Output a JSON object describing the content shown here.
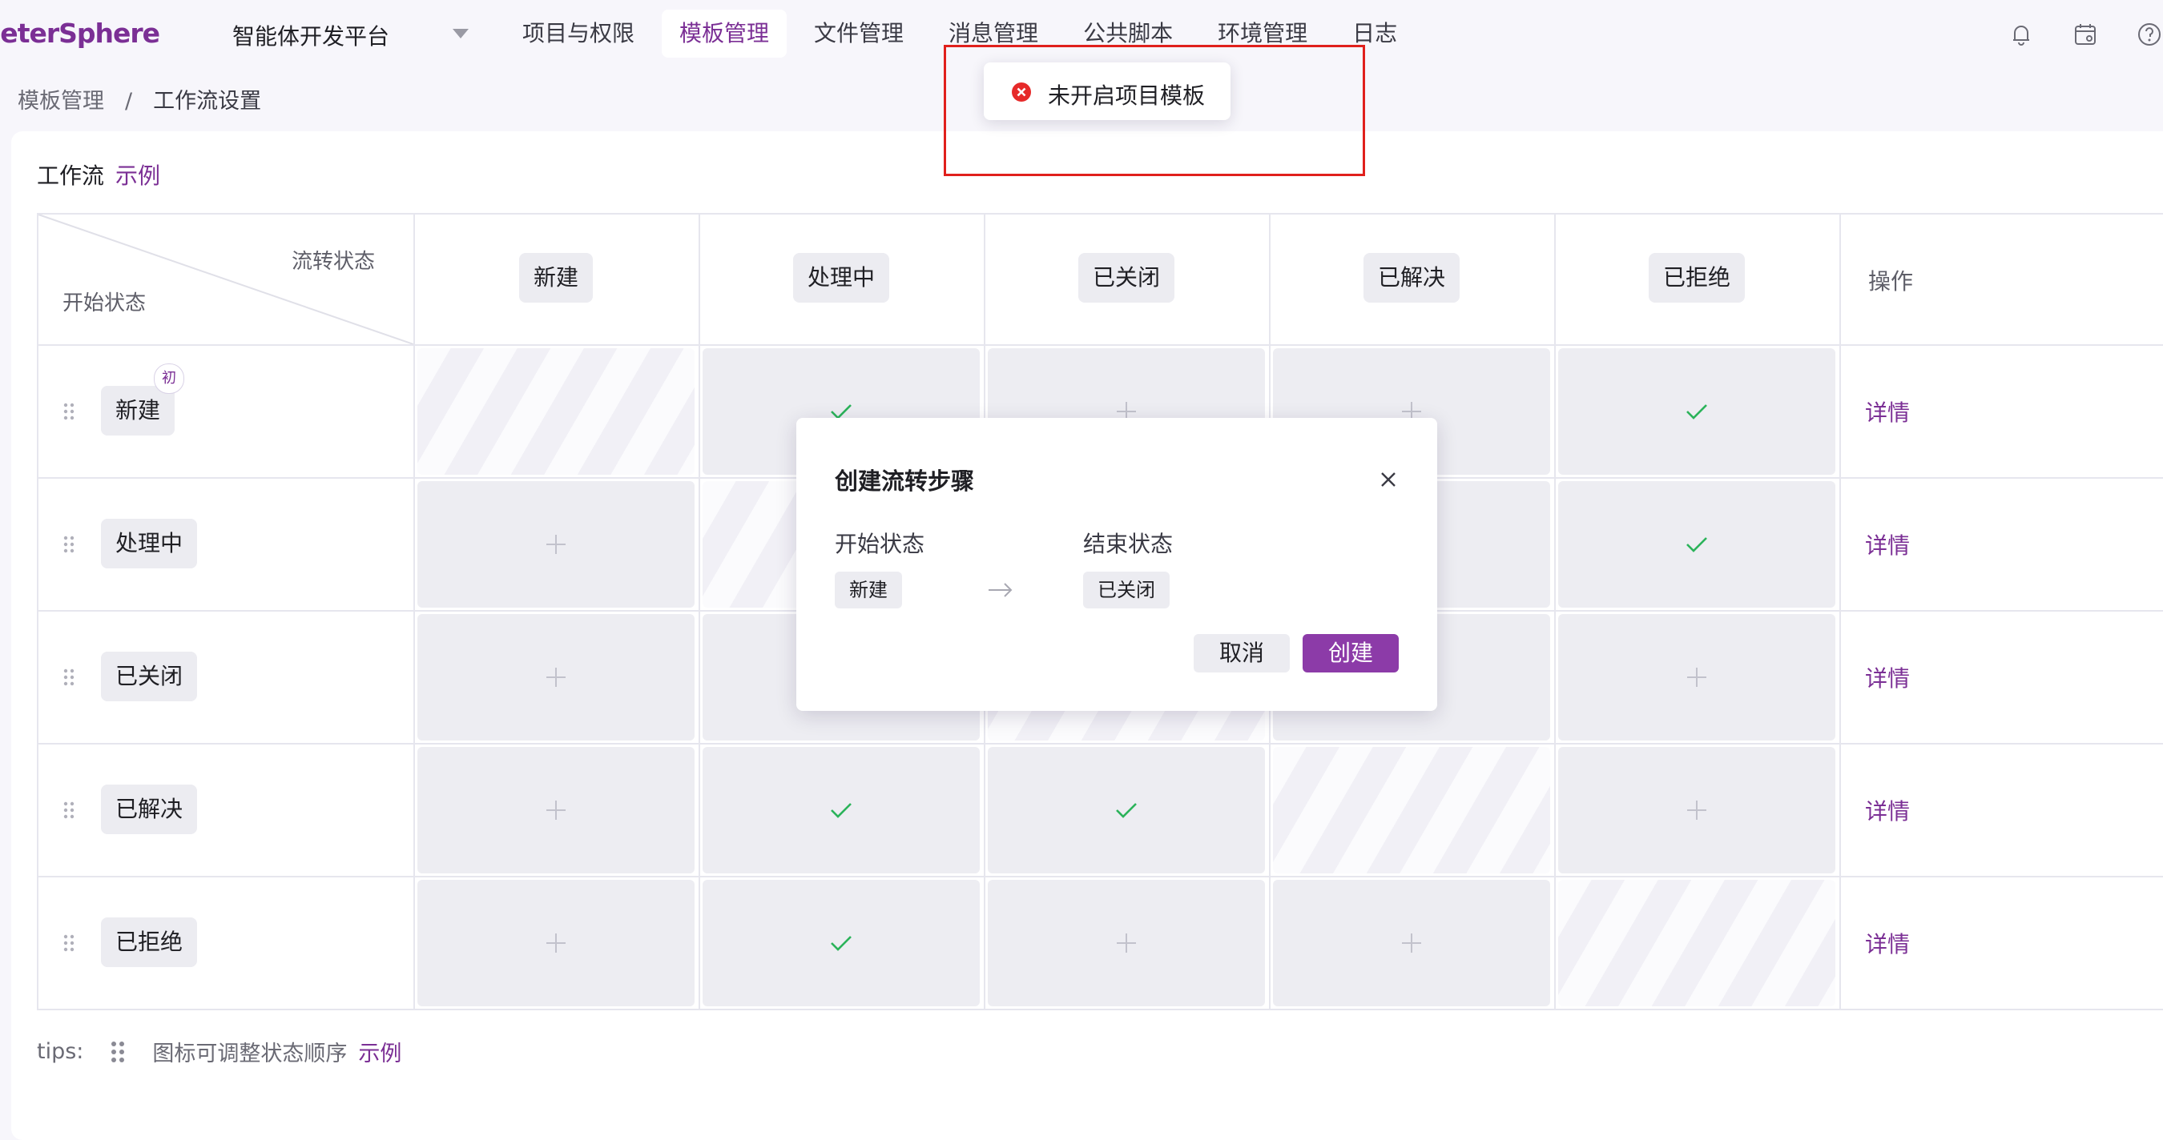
{
  "app": {
    "logo": "leterSphere",
    "platform": "智能体开发平台"
  },
  "nav": {
    "items": [
      "项目与权限",
      "模板管理",
      "文件管理",
      "消息管理",
      "公共脚本",
      "环境管理",
      "日志"
    ],
    "active_index": 1
  },
  "top_icons": [
    "bell-icon",
    "calendar-icon",
    "help-icon"
  ],
  "breadcrumb": {
    "parent": "模板管理",
    "separator": "/",
    "current": "工作流设置"
  },
  "workflow": {
    "title": "工作流",
    "example_link": "示例",
    "corner_top": "流转状态",
    "corner_bottom": "开始状态",
    "op_header": "操作",
    "initial_badge": "初",
    "detail_label": "详情",
    "columns": [
      "新建",
      "处理中",
      "已关闭",
      "已解决",
      "已拒绝"
    ],
    "rows": [
      {
        "label": "新建",
        "initial": true,
        "cells": [
          "self",
          "check",
          "plus",
          "plus",
          "check"
        ]
      },
      {
        "label": "处理中",
        "initial": false,
        "cells": [
          "plus",
          "self",
          "plus",
          "plus",
          "check"
        ]
      },
      {
        "label": "已关闭",
        "initial": false,
        "cells": [
          "plus",
          "plus",
          "self",
          "plus",
          "plus"
        ]
      },
      {
        "label": "已解决",
        "initial": false,
        "cells": [
          "plus",
          "check",
          "check",
          "self",
          "plus"
        ]
      },
      {
        "label": "已拒绝",
        "initial": false,
        "cells": [
          "plus",
          "check",
          "plus",
          "plus",
          "self"
        ]
      }
    ]
  },
  "tips": {
    "prefix": "tips:",
    "text": "图标可调整状态顺序",
    "link": "示例"
  },
  "modal": {
    "title": "创建流转步骤",
    "start_label": "开始状态",
    "end_label": "结束状态",
    "start_value": "新建",
    "end_value": "已关闭",
    "cancel_label": "取消",
    "create_label": "创建"
  },
  "toast": {
    "message": "未开启项目模板",
    "type": "error"
  },
  "colors": {
    "brand": "#7b2f95",
    "primary_button": "#8c3ba8",
    "check": "#2bb35a",
    "error": "#e62a2a",
    "highlight_border": "#e0201c"
  }
}
